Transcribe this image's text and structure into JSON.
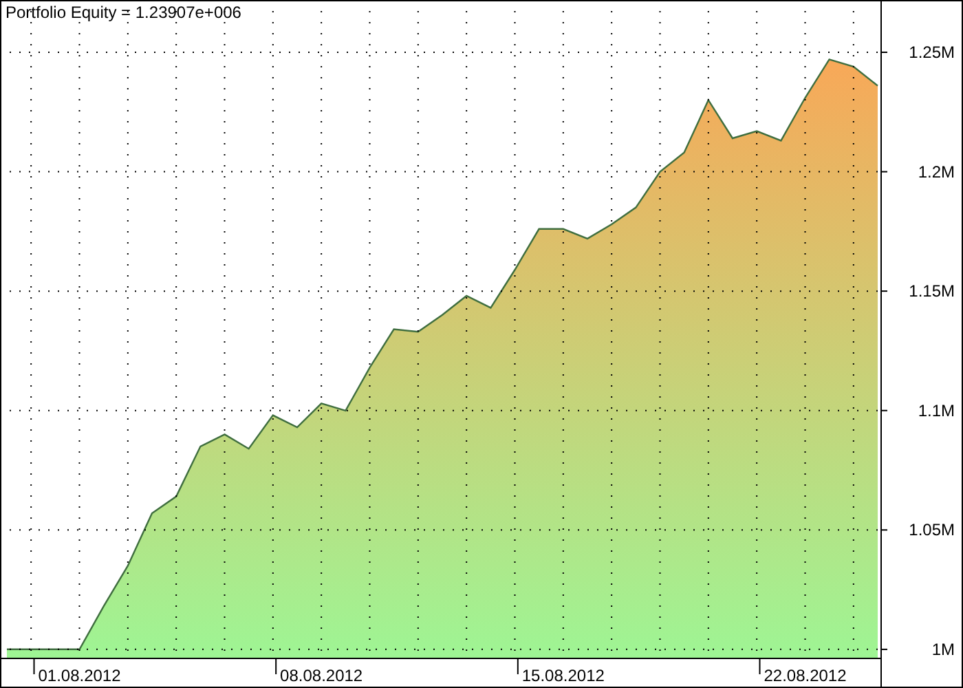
{
  "chart": {
    "chart_data": {
      "type": "area",
      "title": "Portfolio Equity = 1.23907e+006",
      "categories": [
        null,
        null,
        null,
        "01.08.2012",
        null,
        null,
        null,
        null,
        null,
        null,
        null,
        null,
        null,
        "08.08.2012",
        null,
        null,
        null,
        null,
        null,
        null,
        null,
        null,
        null,
        "15.08.2012",
        null,
        null,
        null,
        null,
        null,
        null,
        null,
        null,
        null,
        "22.08.2012",
        null,
        null,
        null
      ],
      "grid": true,
      "series": [
        {
          "color": "#3f6e3f",
          "values": [
            1.0,
            1.0,
            1.0,
            1.0,
            1.018,
            1.035,
            1.057,
            1.064,
            1.085,
            1.09,
            1.084,
            1.098,
            1.093,
            1.103,
            1.1,
            1.118,
            1.134,
            1.133,
            1.14,
            1.148,
            1.143,
            1.159,
            1.176,
            1.176,
            1.172,
            1.178,
            1.185,
            1.2,
            1.208,
            1.23,
            1.214,
            1.217,
            1.213,
            1.231,
            1.247,
            1.244,
            1.236
          ]
        }
      ],
      "ylim": [
        0.9965,
        1.2719
      ],
      "yticks": [
        {
          "value": 1.0,
          "label": "1M"
        },
        {
          "value": 1.05,
          "label": "1.05M"
        },
        {
          "value": 1.1,
          "label": "1.1M"
        },
        {
          "value": 1.15,
          "label": "1.15M"
        },
        {
          "value": 1.2,
          "label": "1.2M"
        },
        {
          "value": 1.25,
          "label": "1.25M"
        }
      ]
    }
  }
}
